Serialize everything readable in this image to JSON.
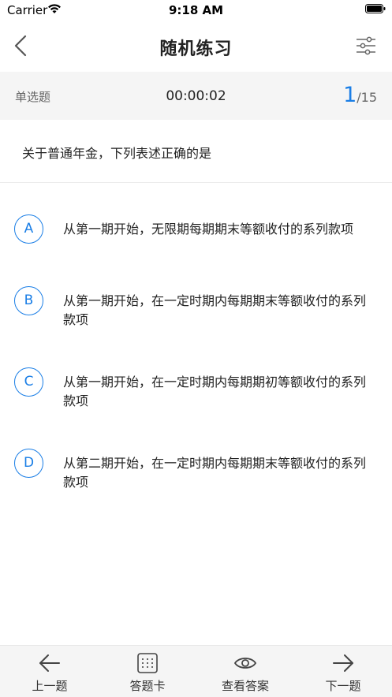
{
  "status": {
    "carrier": "Carrier",
    "time": "9:18 AM"
  },
  "nav": {
    "title": "随机练习"
  },
  "info": {
    "question_type": "单选题",
    "timer": "00:00:02",
    "current": "1",
    "total": "/15"
  },
  "question": {
    "text": "关于普通年金，下列表述正确的是"
  },
  "options": [
    {
      "letter": "A",
      "text": "从第一期开始，无限期每期期末等额收付的系列款项"
    },
    {
      "letter": "B",
      "text": "从第一期开始，在一定时期内每期期末等额收付的系列款项"
    },
    {
      "letter": "C",
      "text": "从第一期开始，在一定时期内每期期初等额收付的系列款项"
    },
    {
      "letter": "D",
      "text": "从第二期开始，在一定时期内每期期末等额收付的系列款项"
    }
  ],
  "bottom": {
    "prev": {
      "label": "上一题",
      "icon": "arrow-left-icon"
    },
    "card": {
      "label": "答题卡",
      "icon": "grid-icon"
    },
    "answer": {
      "label": "查看答案",
      "icon": "eye-icon"
    },
    "next": {
      "label": "下一题",
      "icon": "arrow-right-icon"
    }
  },
  "colors": {
    "accent": "#1a7ee6",
    "bar_bg": "#f5f5f5"
  }
}
